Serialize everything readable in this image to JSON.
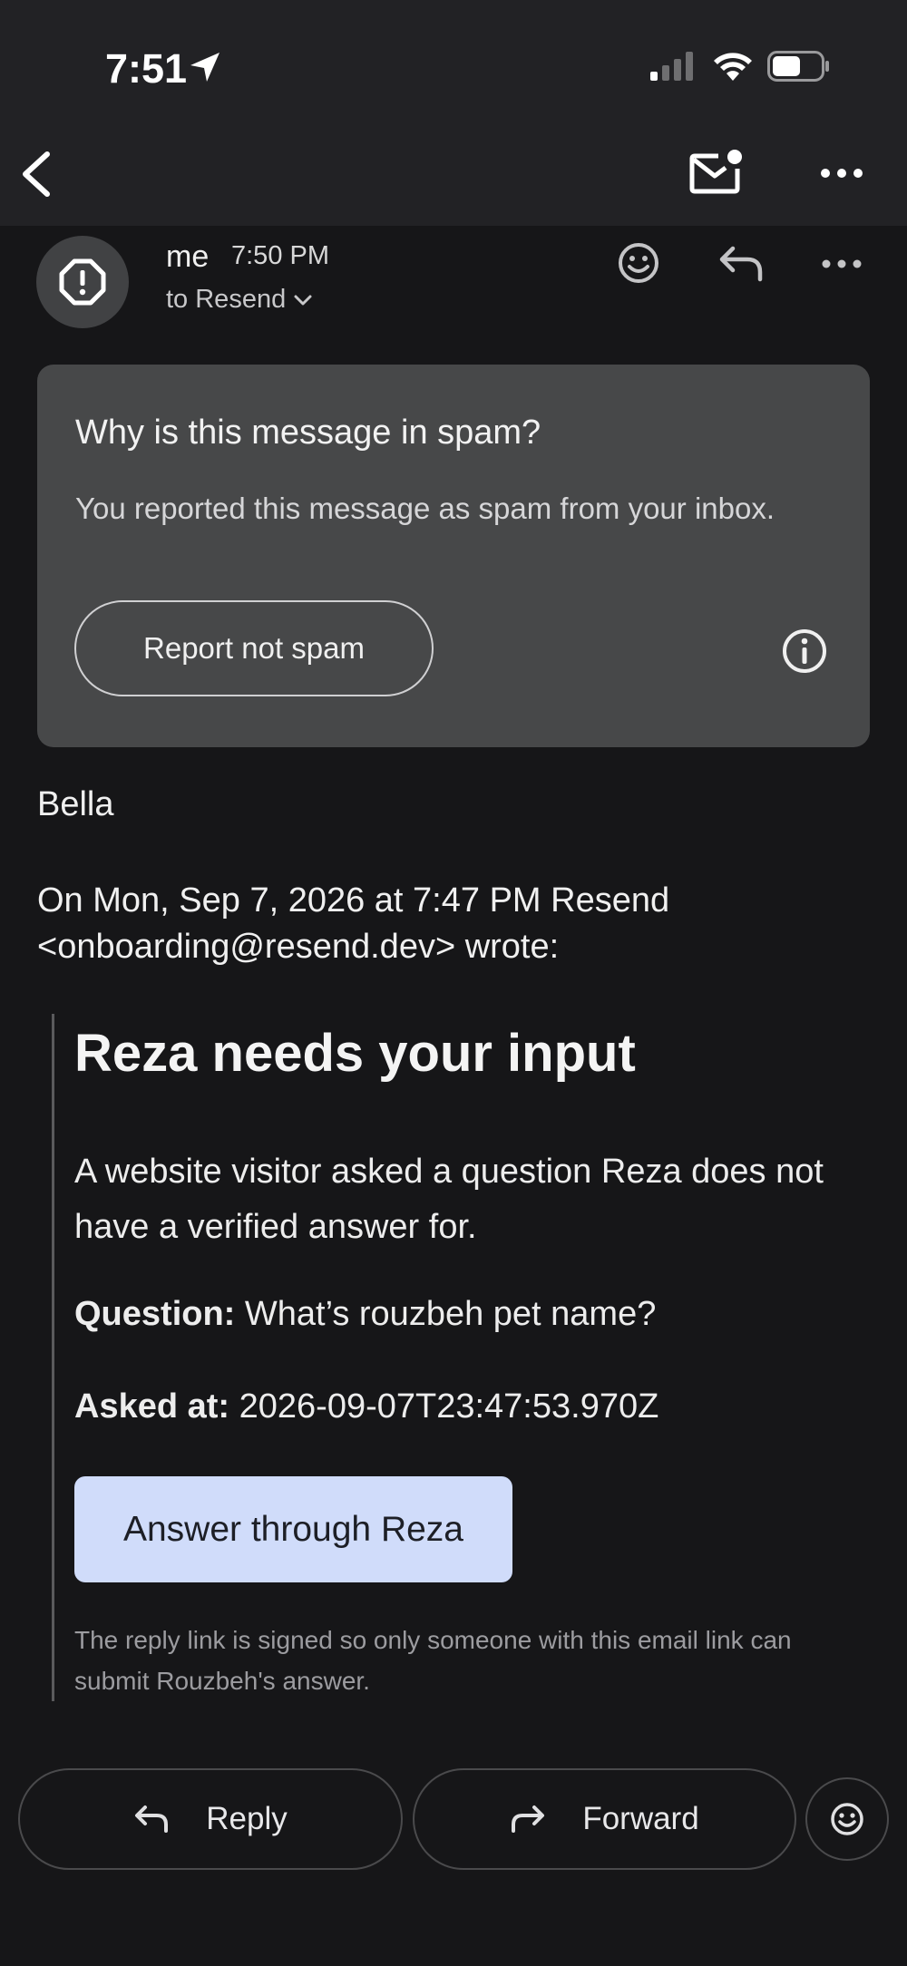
{
  "status_bar": {
    "time": "7:51"
  },
  "message": {
    "sender": "me",
    "time": "7:50 PM",
    "to_line": "to Resend"
  },
  "spam_notice": {
    "title": "Why is this message in spam?",
    "body": "You reported this message as spam from your inbox.",
    "button_label": "Report not spam"
  },
  "body": {
    "greeting": "Bella",
    "quote_header_line1": "On Mon, Sep 7, 2026 at 7:47 PM Resend",
    "quote_header_line2": "<onboarding@resend.dev> wrote:"
  },
  "quoted": {
    "title": "Reza needs your input",
    "intro": "A website visitor asked a question Reza does not have a verified answer for.",
    "question_label": "Question:",
    "question_value": "What’s rouzbeh pet name?",
    "asked_label": "Asked at:",
    "asked_value": "2026-09-07T23:47:53.970Z",
    "button_label": "Answer through Reza",
    "footnote": "The reply link is signed so only someone with this email link can submit Rouzbeh's answer."
  },
  "actions": {
    "reply_label": "Reply",
    "forward_label": "Forward"
  },
  "colors": {
    "background": "#161618",
    "topbar": "#222225",
    "card": "#474849",
    "answer_button": "#d0dcfa"
  }
}
